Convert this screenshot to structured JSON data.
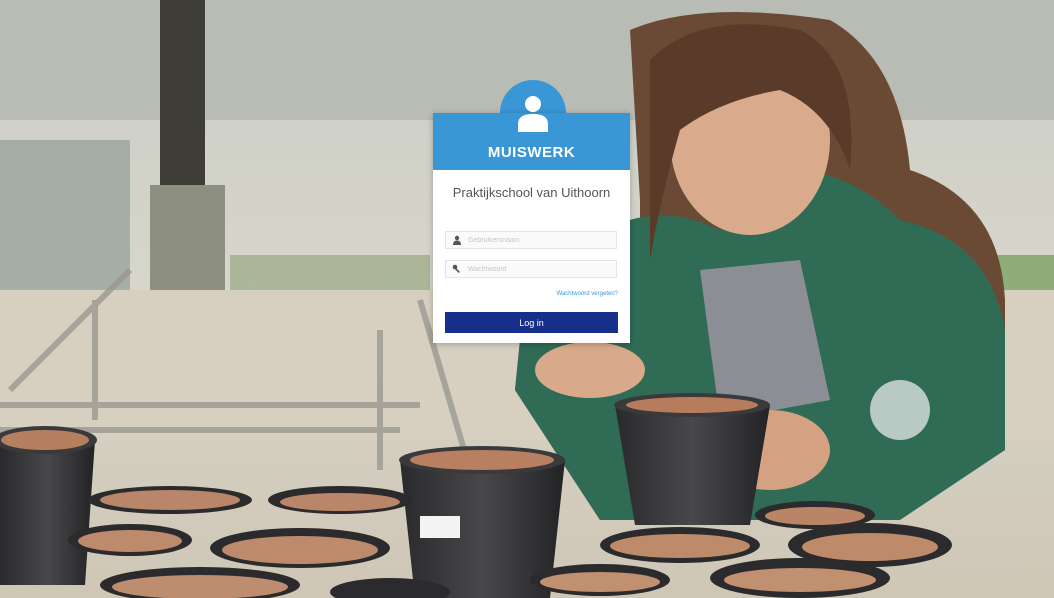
{
  "brand": {
    "name": "MUISWERK"
  },
  "school": {
    "name": "Praktijkschool van Uithoorn"
  },
  "form": {
    "username_placeholder": "Gebruikersnaam",
    "password_placeholder": "Wachtwoord",
    "forgot_link": "Wachtwoord vergeten?",
    "login_button": "Log in"
  },
  "icons": {
    "avatar": "user-avatar-icon",
    "username": "user-icon",
    "password": "key-icon"
  },
  "colors": {
    "header_blue": "#3a97d6",
    "button_navy": "#162f8a"
  }
}
